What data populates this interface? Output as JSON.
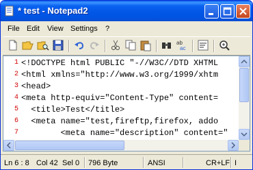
{
  "window": {
    "title": "* test - Notepad2"
  },
  "menu": {
    "items": [
      "File",
      "Edit",
      "View",
      "Settings",
      "?"
    ]
  },
  "toolbar": {
    "icons": [
      "new-file-icon",
      "open-folder-icon",
      "browse-icon",
      "save-icon",
      "undo-icon",
      "redo-icon",
      "cut-icon",
      "copy-icon",
      "paste-icon",
      "find-icon",
      "replace-icon",
      "wordwrap-icon",
      "zoom-in-icon"
    ]
  },
  "editor": {
    "lines": [
      {
        "n": "1",
        "text": "<!DOCTYPE html PUBLIC \"-//W3C//DTD XHTML"
      },
      {
        "n": "2",
        "text": "<html xmlns=\"http://www.w3.org/1999/xhtm"
      },
      {
        "n": "3",
        "text": "<head>"
      },
      {
        "n": "4",
        "text": "<meta http-equiv=\"Content-Type\" content="
      },
      {
        "n": "5",
        "text": "  <title>Test</title>"
      },
      {
        "n": "6",
        "text": "  <meta name=\"test,fireftp,firefox, addo"
      },
      {
        "n": "7",
        "text": "        <meta name=\"description\" content=\""
      }
    ]
  },
  "status": {
    "position": "Ln 6 : 8",
    "column": "Col 42",
    "selection": "Sel 0",
    "size": "796 Byte",
    "encoding": "ANSI",
    "line_endings": "CR+LF",
    "mode": "I"
  }
}
